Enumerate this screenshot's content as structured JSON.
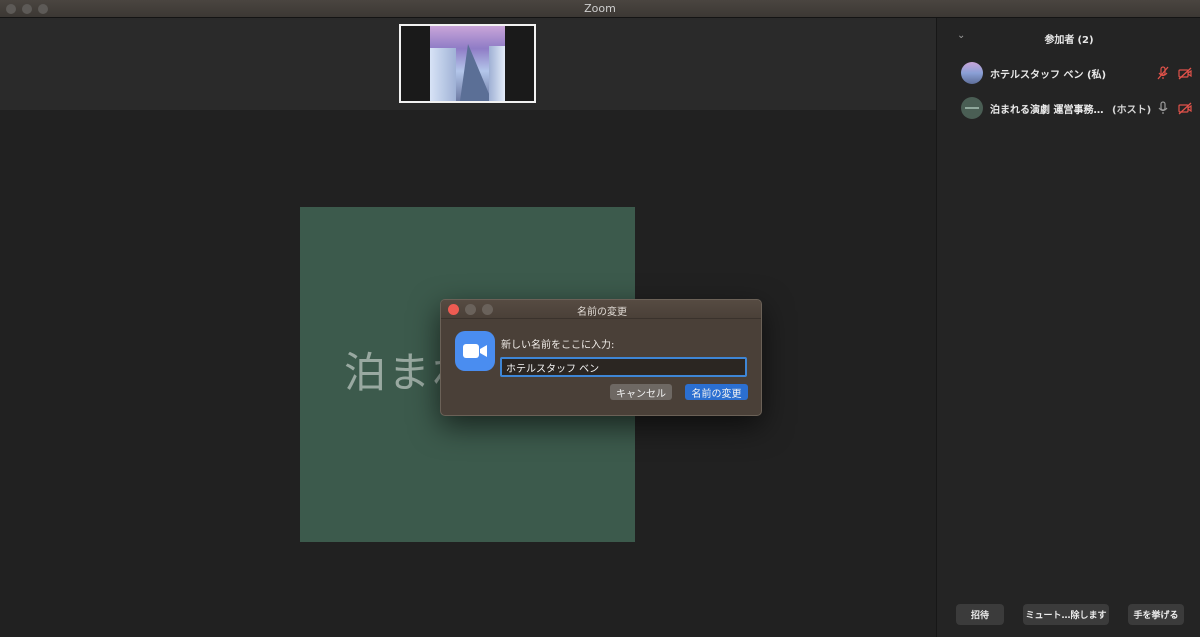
{
  "window": {
    "title": "Zoom"
  },
  "main": {
    "shared_screen_text": "泊まれ"
  },
  "participants": {
    "title": "参加者",
    "count": "(2)",
    "list": [
      {
        "name": "ホテルスタッフ ベン (私)",
        "role": "",
        "mic": "mic-muted-icon",
        "video": "video-off-icon"
      },
      {
        "name": "泊まれる演劇 運営事務…",
        "role": "(ホスト)",
        "mic": "mic-icon",
        "video": "video-off-icon"
      }
    ],
    "buttons": {
      "invite": "招待",
      "mute": "ミュート…除します",
      "raise_hand": "手を挙げる"
    }
  },
  "dialog": {
    "title": "名前の変更",
    "label": "新しい名前をここに入力:",
    "input_value": "ホテルスタッフ ベン",
    "cancel_label": "キャンセル",
    "confirm_label": "名前の変更"
  },
  "colors": {
    "accent": "#2b6fd1",
    "muted_red": "#e0524a",
    "shared_bg": "#3c5a4c"
  }
}
